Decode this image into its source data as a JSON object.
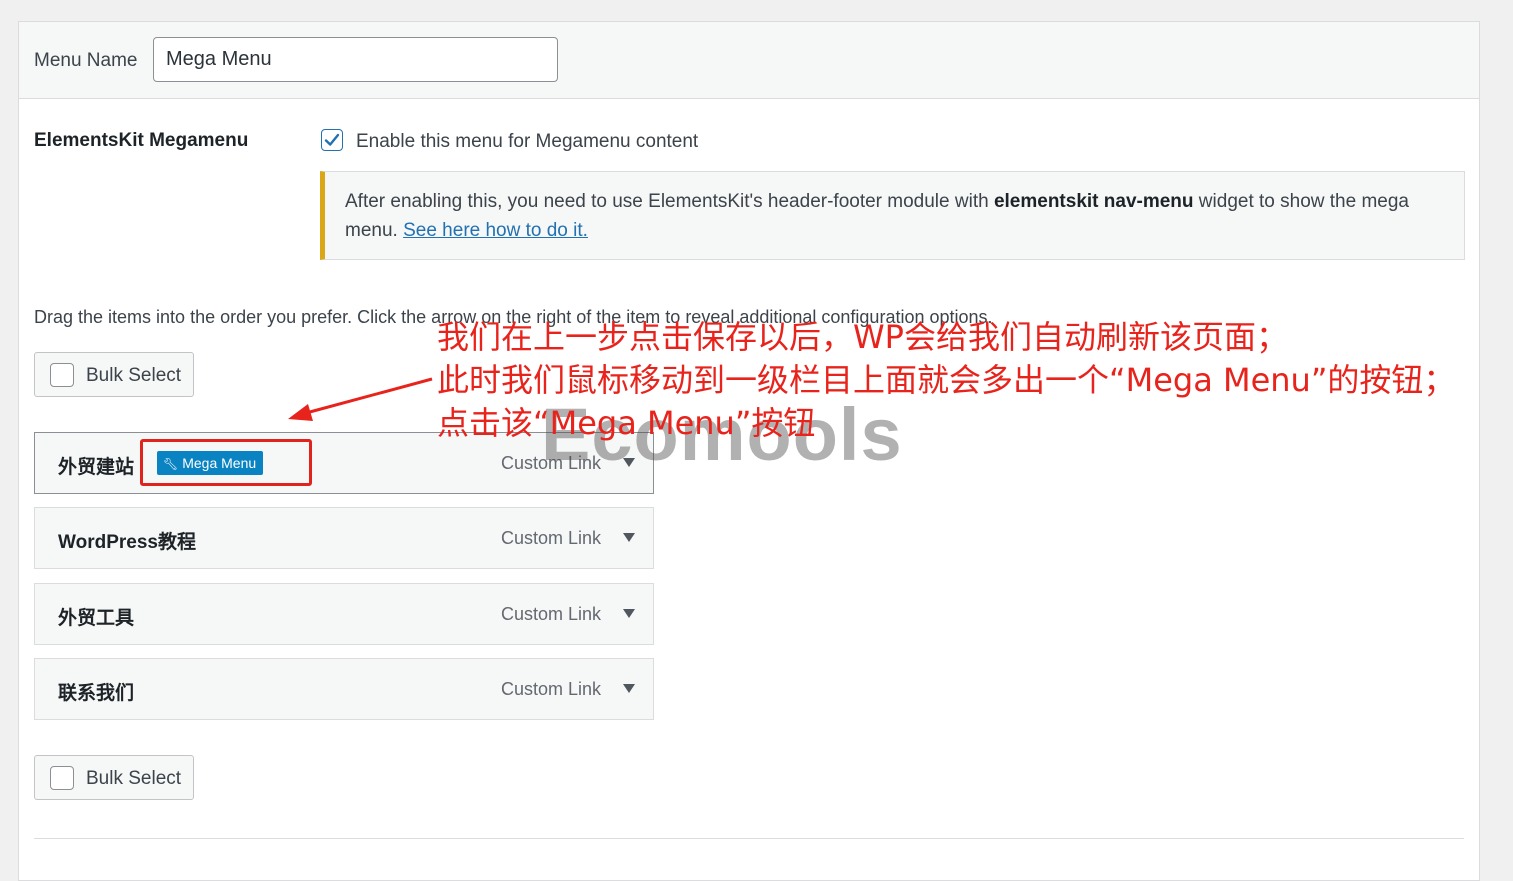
{
  "menu_name": {
    "label": "Menu Name",
    "value": "Mega Menu"
  },
  "elementskit": {
    "label": "ElementsKit Megamenu",
    "checkbox_label": "Enable this menu for Megamenu content",
    "checked": true,
    "notice_prefix": "After enabling this, you need to use ElementsKit's header-footer module with ",
    "notice_bold": "elementskit nav-menu",
    "notice_suffix": " widget to show the mega menu. ",
    "notice_link": "See here how to do it."
  },
  "instructions": "Drag the items into the order you prefer. Click the arrow on the right of the item to reveal additional configuration options.",
  "bulk_select_label": "Bulk Select",
  "mega_menu_button": "Mega Menu",
  "menu_items": [
    {
      "title": "外贸建站",
      "type": "Custom Link"
    },
    {
      "title": "WordPress教程",
      "type": "Custom Link"
    },
    {
      "title": "外贸工具",
      "type": "Custom Link"
    },
    {
      "title": "联系我们",
      "type": "Custom Link"
    }
  ],
  "annotation": {
    "line1": "我们在上一步点击保存以后，WP会给我们自动刷新该页面；",
    "line2": "此时我们鼠标移动到一级栏目上面就会多出一个“Mega Menu”的按钮；",
    "line3": "点击该“Mega Menu”按钮"
  },
  "watermark": "Ecomools",
  "colors": {
    "accent": "#2271b1",
    "mega_button": "#0a83c3",
    "annotation": "#e8231c",
    "notice_border": "#dba617"
  }
}
